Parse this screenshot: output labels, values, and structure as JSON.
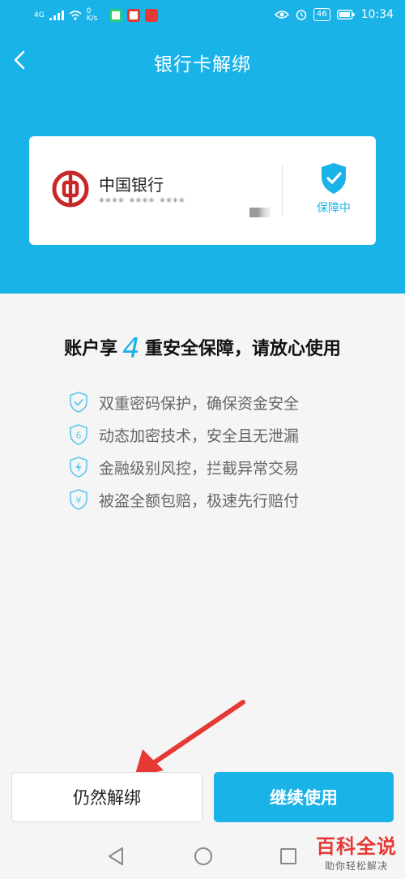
{
  "status_bar": {
    "signal": "4G",
    "net_speed": "0 K/s",
    "badge": "46",
    "time": "10:34"
  },
  "nav": {
    "title": "银行卡解绑"
  },
  "card": {
    "bank_name": "中国银行",
    "masked_number": "**** **** ****",
    "protection_status": "保障中"
  },
  "headline": {
    "prefix": "账户享",
    "number": "4",
    "suffix": "重安全保障，请放心使用"
  },
  "features": [
    {
      "icon": "shield-check-icon",
      "text": "双重密码保护，确保资金安全"
    },
    {
      "icon": "shield-six-icon",
      "text": "动态加密技术，安全且无泄漏"
    },
    {
      "icon": "shield-lightning-icon",
      "text": "金融级别风控，拦截异常交易"
    },
    {
      "icon": "shield-yen-icon",
      "text": "被盗全额包赔，极速先行赔付"
    }
  ],
  "buttons": {
    "unbind": "仍然解绑",
    "continue": "继续使用"
  },
  "watermark": {
    "main": "百科全说",
    "sub": "助你轻松解决"
  },
  "colors": {
    "accent": "#1ab3e8",
    "bank_red": "#c62828",
    "arrow_red": "#e53935"
  }
}
